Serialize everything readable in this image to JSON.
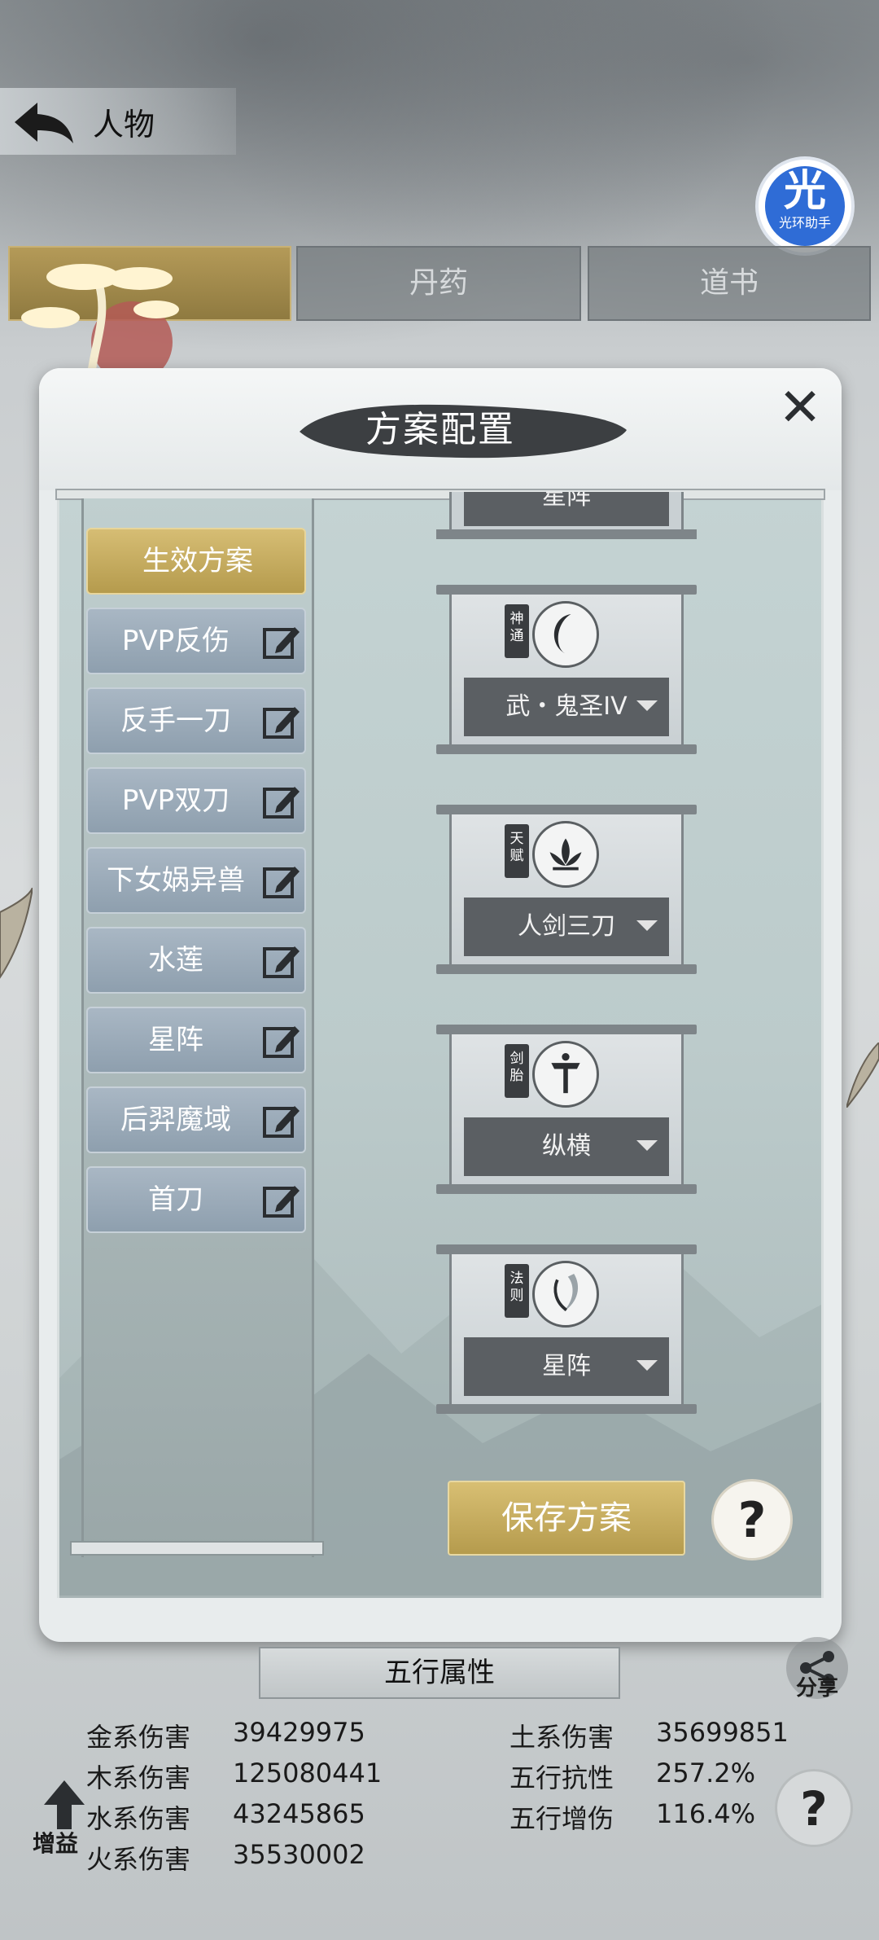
{
  "header": {
    "title": "人物"
  },
  "helper": {
    "glyph": "光",
    "label": "光环助手"
  },
  "tabs": [
    {
      "label": ""
    },
    {
      "label": "丹药"
    },
    {
      "label": "道书"
    }
  ],
  "modal": {
    "title": "方案配置",
    "plans": [
      {
        "label": "生效方案",
        "active": true
      },
      {
        "label": "PVP反伤"
      },
      {
        "label": "反手一刀"
      },
      {
        "label": "PVP双刀"
      },
      {
        "label": "下女娲异兽"
      },
      {
        "label": "水莲"
      },
      {
        "label": "星阵"
      },
      {
        "label": "后羿魔域"
      },
      {
        "label": "首刀"
      }
    ],
    "partial_card": {
      "value": "星阵"
    },
    "cards": [
      {
        "tag": "神通",
        "value": "武・鬼圣IV",
        "icon": "crescent-icon"
      },
      {
        "tag": "天赋",
        "value": "人剑三刀",
        "icon": "lotus-icon"
      },
      {
        "tag": "剑胎",
        "value": "纵横",
        "icon": "sword-icon"
      },
      {
        "tag": "法则",
        "value": "星阵",
        "icon": "swirl-icon"
      }
    ],
    "save_label": "保存方案",
    "help_label": "?"
  },
  "wuxing": {
    "title": "五行属性",
    "left": [
      {
        "label": "金系伤害",
        "value": "39429975"
      },
      {
        "label": "木系伤害",
        "value": "125080441"
      },
      {
        "label": "水系伤害",
        "value": "43245865"
      },
      {
        "label": "火系伤害",
        "value": "35530002"
      }
    ],
    "right": [
      {
        "label": "土系伤害",
        "value": "35699851"
      },
      {
        "label": "五行抗性",
        "value": "257.2%"
      },
      {
        "label": "五行增伤",
        "value": "116.4%"
      }
    ]
  },
  "share_label": "分享",
  "boost_label": "增益",
  "help2_label": "?"
}
